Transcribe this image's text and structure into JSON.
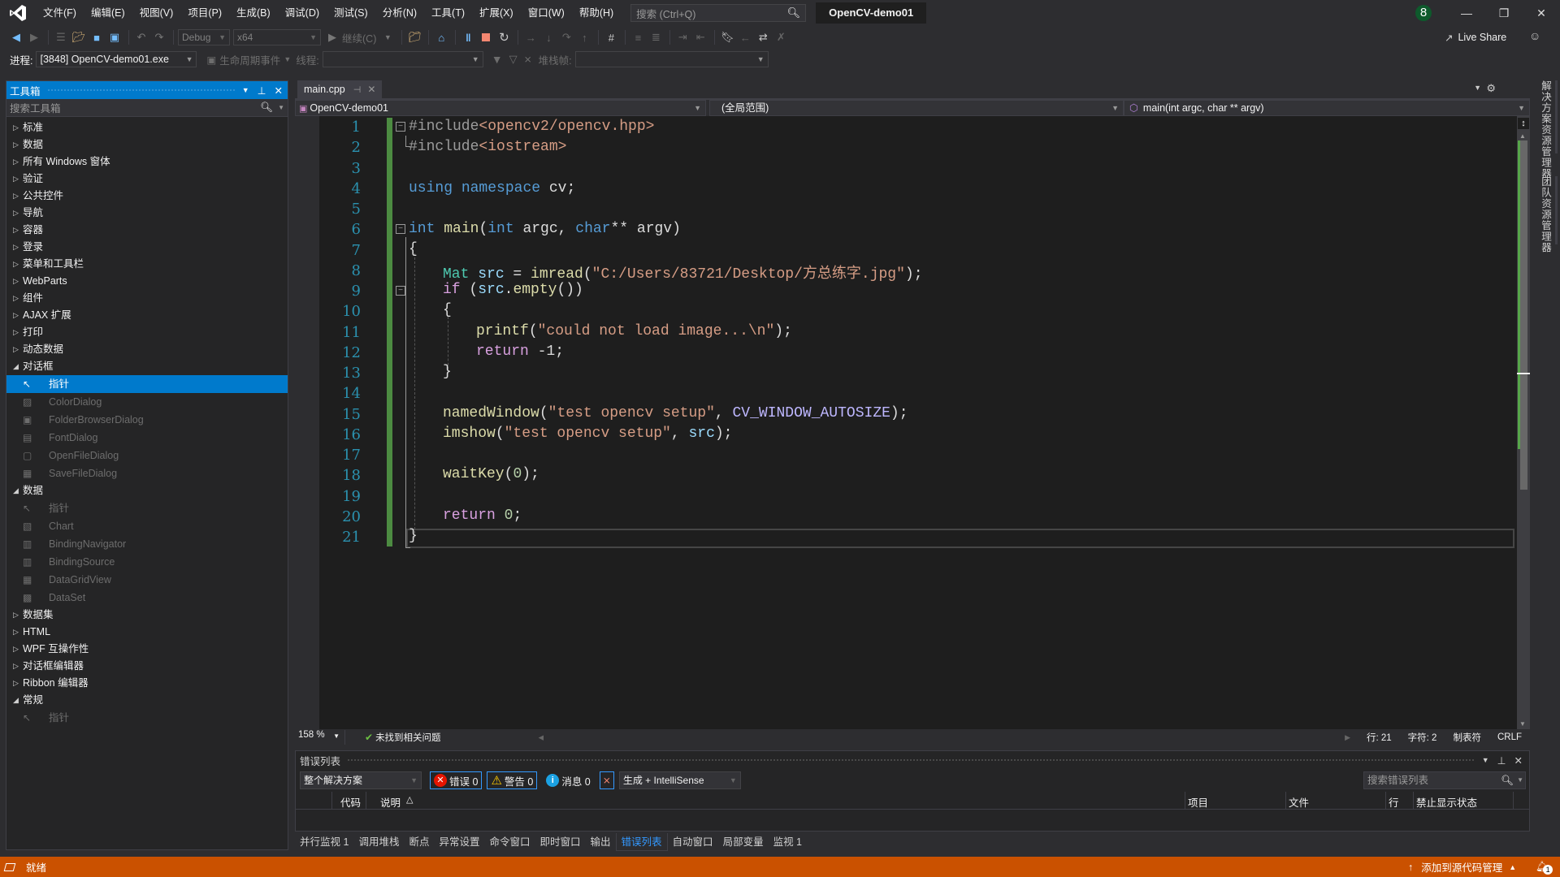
{
  "titlebar": {
    "menus": [
      "文件(F)",
      "编辑(E)",
      "视图(V)",
      "项目(P)",
      "生成(B)",
      "调试(D)",
      "测试(S)",
      "分析(N)",
      "工具(T)",
      "扩展(X)",
      "窗口(W)",
      "帮助(H)"
    ],
    "search_placeholder": "搜索 (Ctrl+Q)",
    "project_title": "OpenCV-demo01",
    "notification_badge": "8"
  },
  "toolbar": {
    "config": "Debug",
    "platform": "x64",
    "continue_label": "继续(C)",
    "live_share": "Live Share"
  },
  "procbar": {
    "process_label": "进程:",
    "process_value": "[3848] OpenCV-demo01.exe",
    "lifecycle_label": "生命周期事件",
    "thread_label": "线程:",
    "stack_label": "堆栈帧:"
  },
  "toolbox": {
    "title": "工具箱",
    "search_placeholder": "搜索工具箱",
    "groups_top": [
      "标准",
      "数据",
      "所有 Windows 窗体",
      "验证",
      "公共控件",
      "导航",
      "容器",
      "登录",
      "菜单和工具栏",
      "WebParts",
      "组件",
      "AJAX 扩展",
      "打印",
      "动态数据"
    ],
    "dialog_group": "对话框",
    "dialog_items": [
      "指针",
      "ColorDialog",
      "FolderBrowserDialog",
      "FontDialog",
      "OpenFileDialog",
      "SaveFileDialog"
    ],
    "data_group": "数据",
    "data_items": [
      "指针",
      "Chart",
      "BindingNavigator",
      "BindingSource",
      "DataGridView",
      "DataSet"
    ],
    "groups_mid": [
      "数据集",
      "HTML",
      "WPF 互操作性",
      "对话框编辑器",
      "Ribbon 编辑器"
    ],
    "general_group": "常规",
    "general_items": [
      "指针"
    ]
  },
  "editor": {
    "tab_label": "main.cpp",
    "nav_project": "OpenCV-demo01",
    "nav_scope": "(全局范围)",
    "nav_member": "main(int argc, char ** argv)",
    "line_numbers": [
      "1",
      "2",
      "3",
      "4",
      "5",
      "6",
      "7",
      "8",
      "9",
      "10",
      "11",
      "12",
      "13",
      "14",
      "15",
      "16",
      "17",
      "18",
      "19",
      "20",
      "21"
    ],
    "code": {
      "l1a": "#include",
      "l1b": "<opencv2/opencv.hpp>",
      "l2a": "#include",
      "l2b": "<iostream>",
      "l4a": "using",
      "l4b": "namespace",
      "l4c": " cv;",
      "l6": [
        "int",
        " ",
        "main",
        "(",
        "int",
        " argc, ",
        "char",
        "** argv)"
      ],
      "l7": "{",
      "l8": [
        "Mat",
        " ",
        "src",
        " = ",
        "imread",
        "(",
        "\"C:/Users/83721/Desktop/方总练字.jpg\"",
        ");"
      ],
      "l9": [
        "if",
        " (",
        "src",
        ".",
        "empty",
        "())"
      ],
      "l10": "{",
      "l11": [
        "printf",
        "(",
        "\"could not load image...\\n\"",
        ");"
      ],
      "l12": [
        "return",
        " -1;"
      ],
      "l13": "}",
      "l15": [
        "namedWindow",
        "(",
        "\"test opencv setup\"",
        ", ",
        "CV_WINDOW_AUTOSIZE",
        ");"
      ],
      "l16": [
        "imshow",
        "(",
        "\"test opencv setup\"",
        ", ",
        "src",
        ");"
      ],
      "l18": [
        "waitKey",
        "(",
        "0",
        ");"
      ],
      "l20": [
        "return",
        " ",
        "0",
        ";"
      ],
      "l21": "}"
    },
    "zoom": "158 %",
    "issues": "未找到相关问题",
    "row": "行: 21",
    "col": "字符: 2",
    "indent": "制表符",
    "eol": "CRLF"
  },
  "errors": {
    "title": "错误列表",
    "scope": "整个解决方案",
    "errors": "错误 0",
    "warnings": "警告 0",
    "messages": "消息 0",
    "source": "生成 + IntelliSense",
    "search_placeholder": "搜索错误列表",
    "columns": [
      "代码",
      "说明",
      "项目",
      "文件",
      "行",
      "禁止显示状态"
    ]
  },
  "bottom_tabs": [
    "并行监视 1",
    "调用堆栈",
    "断点",
    "异常设置",
    "命令窗口",
    "即时窗口",
    "输出",
    "错误列表",
    "自动窗口",
    "局部变量",
    "监视 1"
  ],
  "bottom_tab_active": "错误列表",
  "statusbar": {
    "ready": "就绪",
    "source_control": "添加到源代码管理",
    "notif_count": "1"
  },
  "right_tabs": [
    "解决方案资源管理器",
    "团队资源管理器"
  ]
}
